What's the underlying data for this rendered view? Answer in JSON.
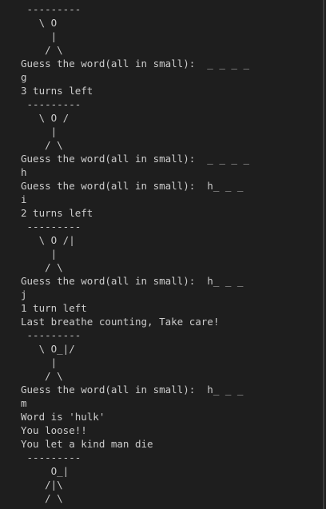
{
  "terminal": {
    "lines": [
      " ---------",
      "   \\ O",
      "     |",
      "    / \\",
      "Guess the word(all in small):  _ _ _ _",
      "g",
      "3 turns left",
      " ---------",
      "   \\ O /",
      "     |",
      "    / \\",
      "Guess the word(all in small):  _ _ _ _",
      "h",
      "Guess the word(all in small):  h_ _ _",
      "i",
      "2 turns left",
      " ---------",
      "   \\ O /|",
      "     |",
      "    / \\",
      "Guess the word(all in small):  h_ _ _",
      "j",
      "1 turn left",
      "Last breathe counting, Take care!",
      " ---------",
      "   \\ O_|/",
      "     |",
      "    / \\",
      "Guess the word(all in small):  h_ _ _",
      "m",
      "Word is 'hulk'",
      "You loose!!",
      "You let a kind man die",
      " ---------",
      "     O_|",
      "    /|\\",
      "    / \\"
    ]
  }
}
